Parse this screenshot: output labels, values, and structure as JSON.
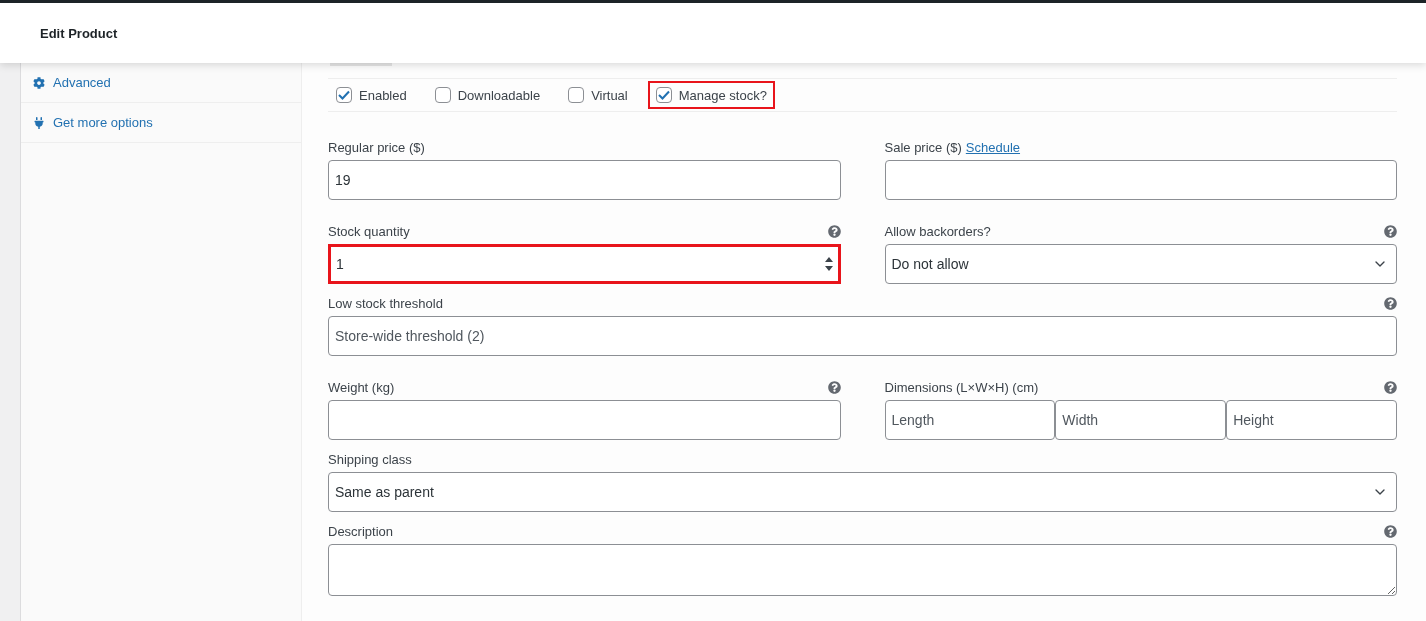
{
  "header": {
    "title": "Edit Product"
  },
  "sidebar": {
    "items": [
      {
        "label": "Advanced"
      },
      {
        "label": "Get more options"
      }
    ]
  },
  "options": [
    {
      "label": "Enabled",
      "checked": true,
      "highlighted": false
    },
    {
      "label": "Downloadable",
      "checked": false,
      "highlighted": false
    },
    {
      "label": "Virtual",
      "checked": false,
      "highlighted": false
    },
    {
      "label": "Manage stock?",
      "checked": true,
      "highlighted": true
    }
  ],
  "rows": [
    [
      {
        "kind": "text",
        "label": "Regular price ($)",
        "help": false,
        "value": "19"
      },
      {
        "kind": "text",
        "label": "Sale price ($)",
        "link": "Schedule",
        "help": false
      }
    ],
    [
      {
        "kind": "number",
        "label": "Stock quantity",
        "help": true,
        "value": "1",
        "highlighted": true
      },
      {
        "kind": "select",
        "label": "Allow backorders?",
        "help": true,
        "value": "Do not allow"
      }
    ],
    [
      {
        "kind": "text",
        "label": "Low stock threshold",
        "help": true,
        "placeholder": "Store-wide threshold (2)"
      }
    ],
    [
      {
        "kind": "text",
        "label": "Weight (kg)",
        "help": true
      },
      {
        "kind": "dimensions",
        "label": "Dimensions (L×W×H) (cm)",
        "help": true,
        "placeholders": [
          "Length",
          "Width",
          "Height"
        ]
      }
    ],
    [
      {
        "kind": "select",
        "label": "Shipping class",
        "help": false,
        "value": "Same as parent"
      }
    ],
    [
      {
        "kind": "textarea",
        "label": "Description",
        "help": true
      }
    ]
  ]
}
